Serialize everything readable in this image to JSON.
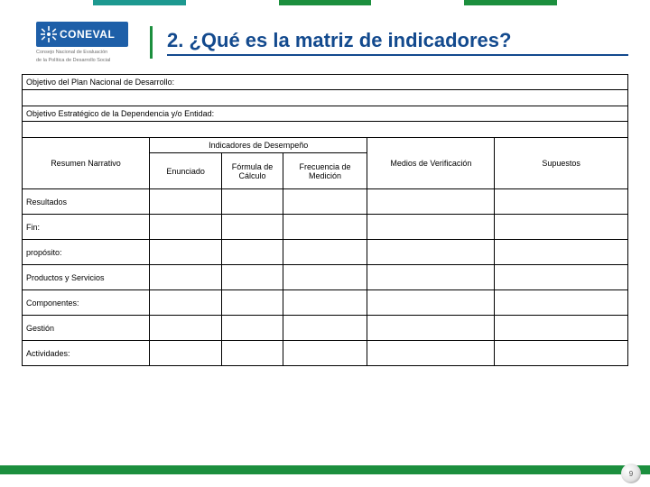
{
  "brand": {
    "logo_text": "CONEVAL",
    "logo_subline1": "Consejo Nacional de Evaluación",
    "logo_subline2": "de la Política de Desarrollo Social"
  },
  "title": "2. ¿Qué es la matriz de indicadores?",
  "labels": {
    "objetivo_pnd": "Objetivo del Plan Nacional de Desarrollo:",
    "objetivo_estrategico": "Objetivo Estratégico de la Dependencia y/o Entidad:"
  },
  "columns": {
    "resumen": "Resumen Narrativo",
    "indicadores_group": "Indicadores de Desempeño",
    "enunciado": "Enunciado",
    "formula": "Fórmula de Cálculo",
    "frecuencia": "Frecuencia de Medición",
    "medios": "Medios de Verificación",
    "supuestos": "Supuestos"
  },
  "rows": {
    "resultados": "Resultados",
    "fin": "Fin:",
    "proposito": "propósito:",
    "productos": "Productos y Servicios",
    "componentes": "Componentes:",
    "gestion": "Gestión",
    "actividades": "Actividades:"
  },
  "page_number": "9"
}
